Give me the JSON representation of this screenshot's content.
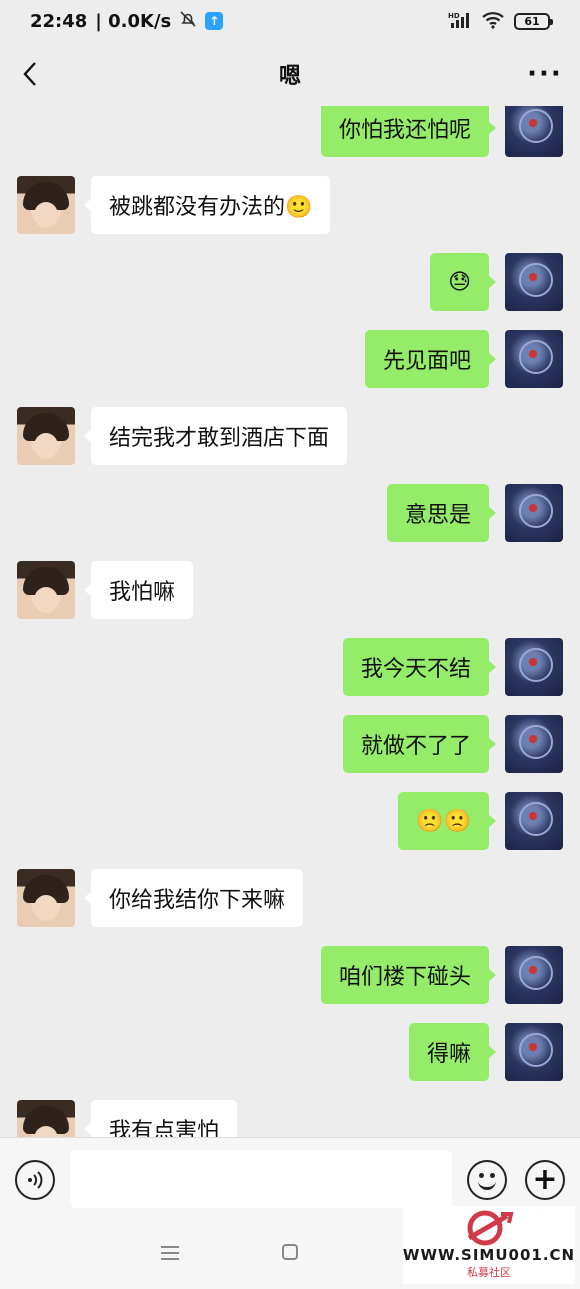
{
  "status_bar": {
    "time": "22:48",
    "speed": "| 0.0K/s",
    "battery": "61",
    "network": "HD"
  },
  "nav": {
    "title": "嗯",
    "more": "···"
  },
  "messages": [
    {
      "side": "out",
      "text": "你怕我还怕呢"
    },
    {
      "side": "in",
      "text": "被跳都没有办法的🙂"
    },
    {
      "side": "out",
      "text": "😓"
    },
    {
      "side": "out",
      "text": "先见面吧"
    },
    {
      "side": "in",
      "text": "结完我才敢到酒店下面"
    },
    {
      "side": "out",
      "text": "意思是"
    },
    {
      "side": "in",
      "text": "我怕嘛"
    },
    {
      "side": "out",
      "text": "我今天不结"
    },
    {
      "side": "out",
      "text": "就做不了了"
    },
    {
      "side": "out",
      "text": "🙁🙁"
    },
    {
      "side": "in",
      "text": "你给我结你下来嘛"
    },
    {
      "side": "out",
      "text": "咱们楼下碰头"
    },
    {
      "side": "out",
      "text": "得嘛"
    },
    {
      "side": "in",
      "text": "我有点害怕"
    }
  ],
  "input": {
    "value": "",
    "placeholder": ""
  },
  "icons": {
    "voice": "voice-icon",
    "emoji": "emoji-icon",
    "plus": "plus-icon"
  },
  "watermark": {
    "url": "WWW.SIMU001.CN",
    "sub": "私募社区"
  },
  "colors": {
    "background": "#ededed",
    "outgoing_bubble": "#95ec69",
    "incoming_bubble": "#ffffff"
  }
}
